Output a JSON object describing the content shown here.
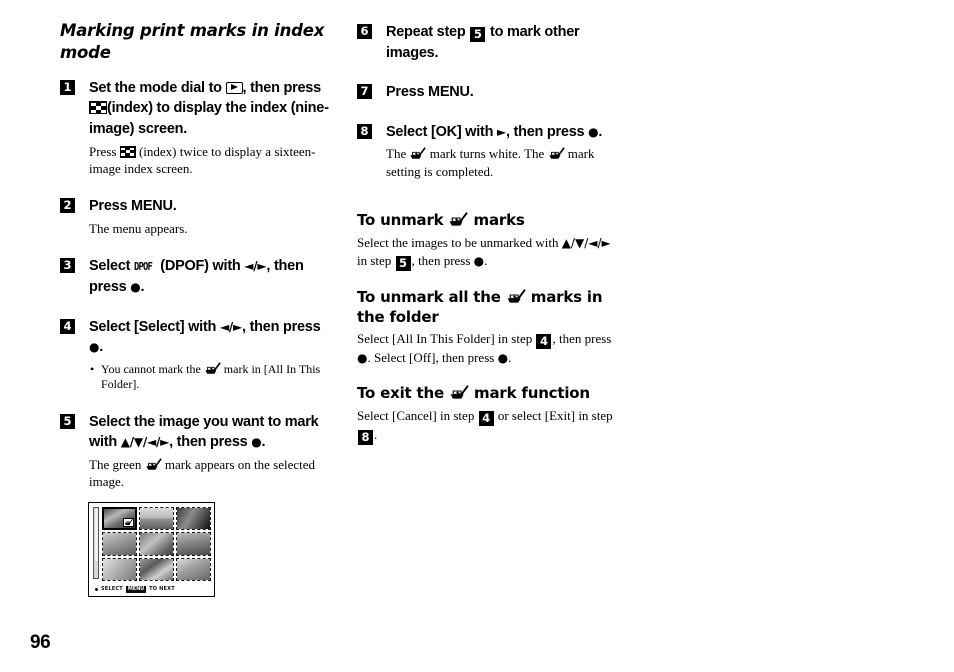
{
  "page": {
    "number": "96"
  },
  "left_column": {
    "section_title": "Marking print marks in index mode",
    "steps": [
      {
        "number": "1",
        "title_part1": "Set the mode dial to",
        "title_part2": ", then press",
        "title_part3": "(index) to display the index (nine-image) screen.",
        "body_part1": "Press",
        "body_part2": "(index) twice to display a sixteen-image index screen."
      },
      {
        "number": "2",
        "title": "Press MENU.",
        "body": "The menu appears."
      },
      {
        "number": "3",
        "title_part1": "Select",
        "dpof_mark": "DPOF",
        "title_part2": "(DPOF) with",
        "arrows": "◄/►",
        "title_part3": ", then press",
        "dot": "●",
        "title_part4": "."
      },
      {
        "number": "4",
        "title_part1": "Select [Select] with",
        "arrows": "◄/►",
        "title_part2": ", then press",
        "dot": "●",
        "title_part3": ".",
        "bullet_part1": "You cannot mark the",
        "bullet_part2": "mark in [All In This Folder]."
      },
      {
        "number": "5",
        "title_part1": "Select the image you want to mark with",
        "arrows": "▲/▼/◄/►",
        "title_part2": ", then press",
        "dot": "●",
        "title_part3": ".",
        "body_part1": "The green",
        "body_part2": "mark appears on the selected image."
      }
    ],
    "figure": {
      "name": "index-nine-image-screen",
      "status_select_label": "SELECT",
      "status_menu_chip": "MENU",
      "status_next_label": "TO NEXT",
      "cells": [
        {
          "selected": true,
          "marked": true,
          "tone": "portrait-a"
        },
        {
          "selected": false,
          "marked": false,
          "tone": "landscape-a"
        },
        {
          "selected": false,
          "marked": false,
          "tone": "building-a"
        },
        {
          "selected": false,
          "marked": false,
          "tone": "portrait-b"
        },
        {
          "selected": false,
          "marked": false,
          "tone": "animal-a"
        },
        {
          "selected": false,
          "marked": false,
          "tone": "group-a"
        },
        {
          "selected": false,
          "marked": false,
          "tone": "nature-a"
        },
        {
          "selected": false,
          "marked": false,
          "tone": "flower-a"
        },
        {
          "selected": false,
          "marked": false,
          "tone": "portrait-c"
        }
      ]
    }
  },
  "right_column": {
    "steps": [
      {
        "number": "6",
        "title_part1": "Repeat step",
        "ref_step": "5",
        "title_part2": "to mark other images."
      },
      {
        "number": "7",
        "title": "Press MENU."
      },
      {
        "number": "8",
        "title_part1": "Select [OK] with",
        "arrow": "►",
        "title_part2": ", then press",
        "dot": "●",
        "title_part3": ".",
        "body_part1": "The",
        "body_part2": "mark turns white. The",
        "body_part3": "mark setting is completed."
      }
    ],
    "sections": [
      {
        "heading_part1": "To unmark",
        "heading_part2": "marks",
        "body_part1": "Select the images to be unmarked with",
        "arrows": "▲/▼/◄/►",
        "body_part2": "in step",
        "ref_step": "5",
        "body_part3": ", then press",
        "dot": "●",
        "body_part4": "."
      },
      {
        "heading_part1": "To unmark all the",
        "heading_part2": "marks in the folder",
        "body_part1": "Select [All In This Folder] in step",
        "ref_step": "4",
        "body_part2": ", then press",
        "dot": "●",
        "body_part3": ". Select [Off], then press",
        "body_part4": "."
      },
      {
        "heading_part1": "To exit the",
        "heading_part2": "mark function",
        "body_part1": "Select [Cancel] in step",
        "ref_step": "4",
        "body_part2": "or select [Exit] in step",
        "ref_step2": "8",
        "body_part3": "."
      }
    ]
  },
  "icons": {
    "playback": "playback-mode-icon",
    "index": "index-checkerboard-icon",
    "print_mark": "print-mark-icon"
  }
}
